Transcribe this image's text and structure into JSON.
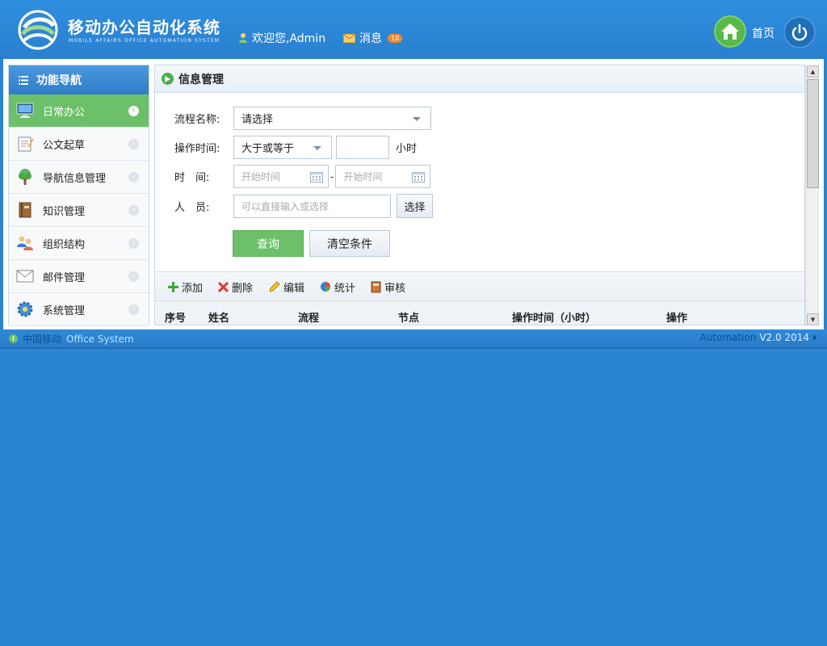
{
  "header": {
    "title": "移动办公自动化系统",
    "subtitle": "MOBILE AFFAIRS OFFICE AUTOMATION SYSTEM",
    "welcome": "欢迎您,Admin",
    "messages_label": "消息",
    "messages_count": "10",
    "home_label": "首页"
  },
  "sidebar": {
    "title": "功能导航",
    "items": [
      {
        "label": "日常办公",
        "icon": "monitor-icon"
      },
      {
        "label": "公文起草",
        "icon": "notepad-icon"
      },
      {
        "label": "导航信息管理",
        "icon": "tree-icon"
      },
      {
        "label": "知识管理",
        "icon": "book-icon"
      },
      {
        "label": "组织结构",
        "icon": "users-icon"
      },
      {
        "label": "邮件管理",
        "icon": "envelope-icon"
      },
      {
        "label": "系统管理",
        "icon": "gear-icon"
      }
    ]
  },
  "panel": {
    "title": "信息管理",
    "form": {
      "process_label": "流程名称:",
      "process_value": "请选择",
      "optime_label": "操作时间:",
      "optime_op": "大于或等于",
      "optime_value": "",
      "optime_unit": "小时",
      "time_label": "时　间:",
      "start_placeholder": "开始时间",
      "range_sep": "-",
      "end_placeholder": "开始时间",
      "person_label": "人　员:",
      "person_placeholder": "可以直接输入或选择",
      "choose_button": "选择",
      "query_button": "查询",
      "clear_button": "清空条件"
    },
    "toolbar": {
      "add": "添加",
      "delete": "删除",
      "edit": "编辑",
      "stats": "统计",
      "review": "审核"
    },
    "table": {
      "columns": [
        "序号",
        "姓名",
        "流程",
        "节点",
        "操作时间（小时）",
        "操作"
      ]
    }
  },
  "footer": {
    "company": "中国移动",
    "system": "Office System",
    "product": "Automation",
    "version": "V2.0 2014"
  }
}
